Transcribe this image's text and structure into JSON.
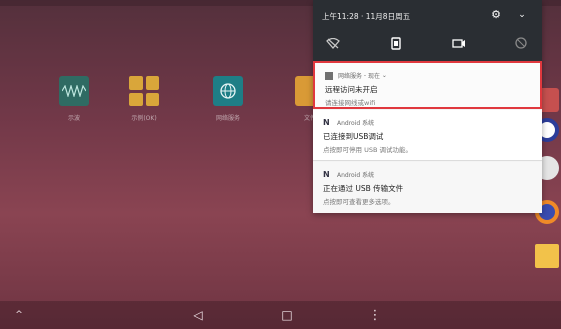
{
  "status_bar": {
    "time_date": "上午11:28 · 11月8日周五"
  },
  "quick_settings": {
    "settings_icon": "gear-icon",
    "expand_icon": "chevron-down-icon",
    "tiles": [
      "wifi-icon",
      "rotation-icon",
      "cast-icon",
      "data-saver-icon"
    ]
  },
  "notifications": [
    {
      "app": "网络服务",
      "time": "现在",
      "title": "远程访问未开启",
      "text": "请连接网线或wifi",
      "highlight_color": "#e0383e"
    },
    {
      "app": "Android 系统",
      "title": "已连接到USB调试",
      "text": "点按即可停用 USB 调试功能。"
    },
    {
      "app": "Android 系统",
      "title": "正在通过 USB 传输文件",
      "text": "点按即可查看更多选项。"
    }
  ],
  "desktop": {
    "apps": [
      {
        "label": "示波",
        "icon": "waveform-icon"
      },
      {
        "label": "示例(OK)",
        "icon": "app-grid-icon"
      },
      {
        "label": "网络服务",
        "icon": "globe-icon"
      },
      {
        "label": "文件",
        "icon": "folder-icon"
      }
    ]
  },
  "navbar": {
    "up": "^",
    "back": "◁",
    "home": "□",
    "menu": "⋮"
  }
}
